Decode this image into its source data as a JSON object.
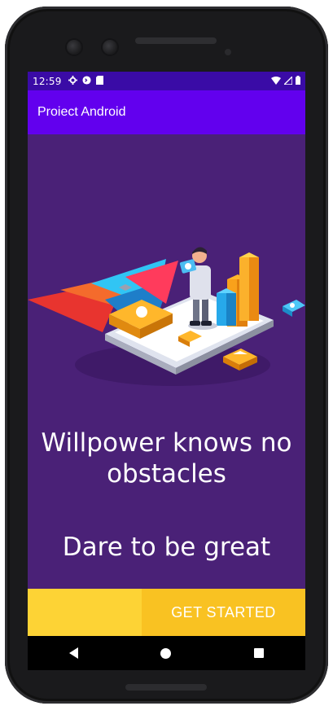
{
  "status_bar": {
    "time": "12:59",
    "icons_left": [
      "settings-icon",
      "sync-icon",
      "sd-card-icon"
    ],
    "icons_right": [
      "wifi-icon",
      "signal-icon",
      "battery-icon"
    ]
  },
  "app_bar": {
    "title": "Proiect Android"
  },
  "main": {
    "quote": "Willpower knows no obstacles",
    "tagline": "Dare to be great",
    "button_label": "GET STARTED"
  },
  "navigation": {
    "back": "back-icon",
    "home": "home-icon",
    "recents": "recents-icon"
  },
  "colors": {
    "status_bar": "#3a0ba6",
    "app_bar": "#6200ee",
    "background": "#4a2177",
    "cta_left": "#fdd335",
    "cta_button": "#f9c222"
  }
}
